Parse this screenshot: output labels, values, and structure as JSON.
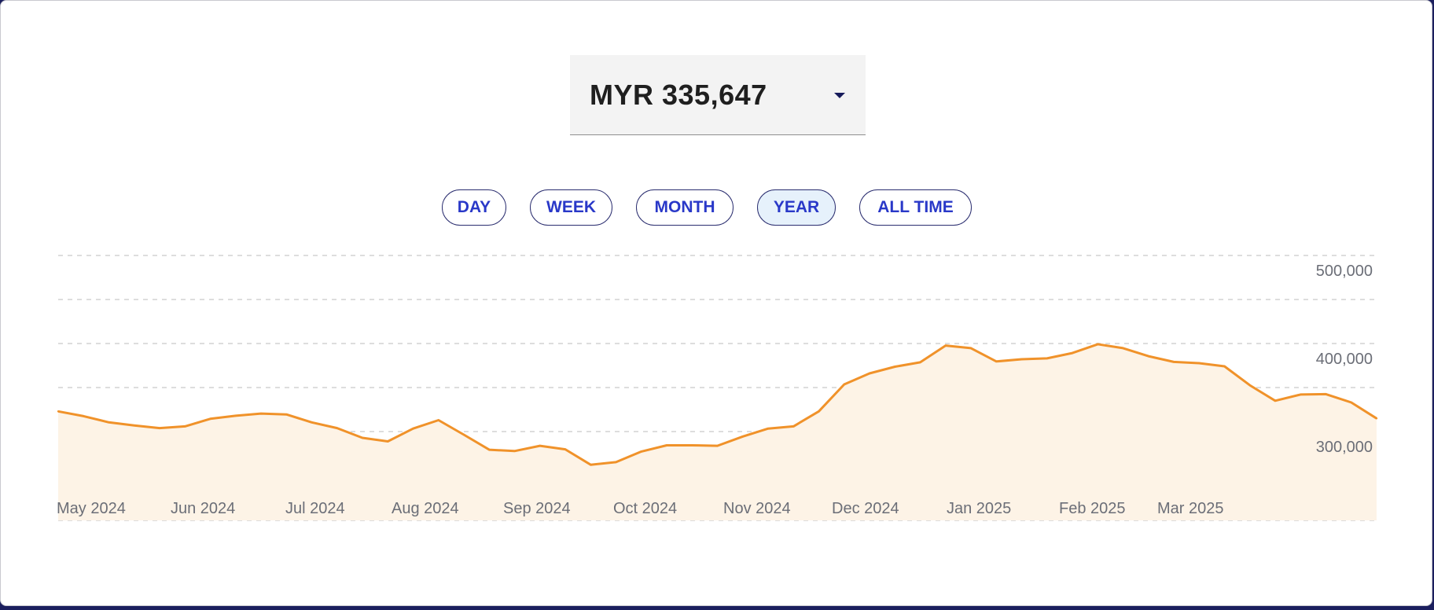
{
  "balance": {
    "display_value": "MYR 335,647"
  },
  "periods": [
    {
      "label": "DAY",
      "active": false
    },
    {
      "label": "WEEK",
      "active": false
    },
    {
      "label": "MONTH",
      "active": false
    },
    {
      "label": "YEAR",
      "active": true
    },
    {
      "label": "ALL TIME",
      "active": false
    }
  ],
  "colors": {
    "line": "#f0922a",
    "fill": "#fdf3e6",
    "grid": "#dddddd",
    "tick_text": "#6b6e77",
    "accent": "#2938c8"
  },
  "chart_data": {
    "type": "area",
    "x_tick_labels": [
      "May 2024",
      "Jun 2024",
      "Jul 2024",
      "Aug 2024",
      "Sep 2024",
      "Oct 2024",
      "Nov 2024",
      "Dec 2024",
      "Jan 2025",
      "Feb 2025",
      "Mar 2025"
    ],
    "y_tick_labels": [
      "500,000",
      "400,000",
      "300,000"
    ],
    "ylim": [
      200000,
      500000
    ],
    "grid": true,
    "series": [
      {
        "values": [
          323500,
          318000,
          311000,
          307500,
          304500,
          306500,
          315000,
          318500,
          321000,
          320000,
          311000,
          304500,
          293500,
          289500,
          304000,
          313500,
          297000,
          280000,
          278500,
          284500,
          280500,
          263000,
          266000,
          278000,
          285000,
          285000,
          284500,
          295000,
          304000,
          306500,
          323500,
          354000,
          366500,
          374000,
          379000,
          398000,
          395000,
          380000,
          382500,
          383500,
          389500,
          399500,
          395000,
          386000,
          379500,
          378000,
          374500,
          353000,
          335500,
          342500,
          343000,
          333500,
          315500
        ]
      }
    ]
  }
}
